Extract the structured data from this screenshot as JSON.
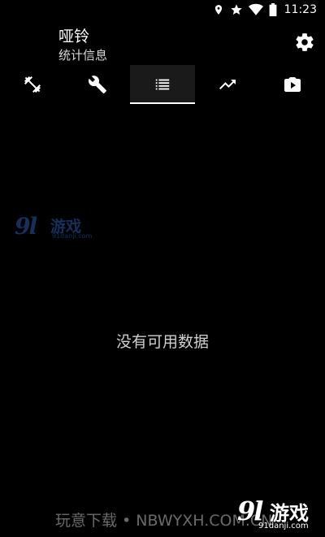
{
  "status_bar": {
    "time": "11:23",
    "icons": [
      "location-icon",
      "star-icon",
      "wifi-icon",
      "battery-icon"
    ]
  },
  "header": {
    "title": "哑铃",
    "subtitle": "统计信息",
    "settings_icon": "gear-icon"
  },
  "tabs": [
    {
      "icon": "dumbbell-icon",
      "active": false
    },
    {
      "icon": "wrench-icon",
      "active": false
    },
    {
      "icon": "list-icon",
      "active": true
    },
    {
      "icon": "trending-up-icon",
      "active": false
    },
    {
      "icon": "video-library-icon",
      "active": false
    }
  ],
  "content": {
    "empty_message": "没有可用数据"
  },
  "watermarks": {
    "left_logo_number": "9l",
    "left_logo_text": "游戏",
    "left_logo_domain": "91danji.com",
    "footer_text": "玩意下载 • NBWYXH.COM.CN",
    "right_logo_number": "9l",
    "right_logo_text": "游戏",
    "right_logo_domain": "91danji.com"
  },
  "colors": {
    "background": "#000000",
    "active_tab": "#1a1a1a",
    "text_primary": "#ffffff",
    "text_muted": "#cfcfcf"
  }
}
